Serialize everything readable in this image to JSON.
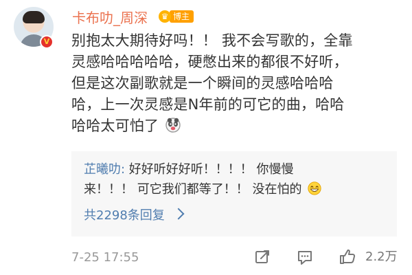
{
  "post": {
    "author": "卡布叻_周深",
    "author_badge": "博主",
    "content_lines": [
      "别抱太大期待好吗！！ 我不会写歌的，全靠",
      "灵感哈哈哈哈哈，硬憋出来的都很不好听，",
      "但是这次副歌就是一个瞬间的灵感哈哈哈",
      "哈，上一次灵感是N年前的可它的曲，哈哈",
      "哈哈太可怕了"
    ],
    "timestamp": "7-25 17:55",
    "like_count": "2.2万"
  },
  "reply": {
    "user": "芷曦叻:",
    "line1": " 好好听好好听！！！！ 你慢慢",
    "line2": "来！！！ 可它我们都等了！！ 没在怕的",
    "more_replies": "共2298条回复"
  },
  "icons": {
    "verified": "verified-badge-icon",
    "rank": "crown-icon",
    "emoji_1": "panda-emoji-icon",
    "emoji_2": "grin-emoji-icon",
    "share": "share-edit-icon",
    "comment": "comment-icon",
    "like": "thumb-up-icon"
  },
  "colors": {
    "author": "#eb7350",
    "link": "#507daf",
    "text": "#333333",
    "muted": "#999999",
    "reply_bg": "#f7f7f7",
    "badge": "#ffa000",
    "verified": "#e4312b"
  }
}
